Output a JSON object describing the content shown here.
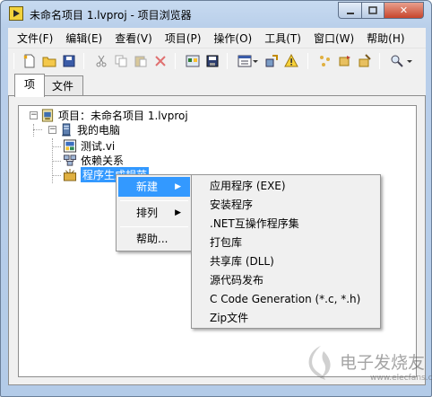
{
  "window": {
    "title": "未命名项目 1.lvproj - 项目浏览器",
    "min_icon": "minimize-icon",
    "max_icon": "maximize-icon",
    "close_glyph": "✕"
  },
  "menubar": [
    {
      "label": "文件(F)"
    },
    {
      "label": "编辑(E)"
    },
    {
      "label": "查看(V)"
    },
    {
      "label": "项目(P)"
    },
    {
      "label": "操作(O)"
    },
    {
      "label": "工具(T)"
    },
    {
      "label": "窗口(W)"
    },
    {
      "label": "帮助(H)"
    }
  ],
  "toolbar": {
    "icons": [
      "new-file-icon",
      "open-folder-icon",
      "save-all-icon",
      "cut-icon",
      "copy-icon",
      "paste-icon",
      "delete-icon",
      "project-properties-icon",
      "save-project-icon",
      "view-icon",
      "deploy-icon",
      "warning-icon",
      "build-icon",
      "build-all-icon",
      "clean-icon",
      "find-icon"
    ]
  },
  "tabs": [
    {
      "label": "项",
      "active": true
    },
    {
      "label": "文件",
      "active": false
    }
  ],
  "tree": {
    "root": {
      "label": "项目：未命名项目 1.lvproj",
      "expander": "−"
    },
    "computer": {
      "label": "我的电脑",
      "expander": "−"
    },
    "children": [
      {
        "label": "测试.vi",
        "icon": "vi-icon"
      },
      {
        "label": "依赖关系",
        "icon": "dependencies-icon"
      },
      {
        "label": "程序生成规范",
        "icon": "build-spec-icon",
        "selected": true
      }
    ]
  },
  "context_menu": {
    "items": [
      {
        "label": "新建",
        "submenu": true,
        "highlighted": true
      },
      {
        "label": "排列",
        "submenu": true,
        "highlighted": false
      },
      {
        "label": "帮助...",
        "submenu": false,
        "highlighted": false
      }
    ],
    "arrow_glyph": "▶"
  },
  "submenu": {
    "items": [
      "应用程序 (EXE)",
      "安装程序",
      ".NET互操作程序集",
      "打包库",
      "共享库 (DLL)",
      "源代码发布",
      "C Code Generation (*.c, *.h)",
      "Zip文件"
    ]
  },
  "watermark": {
    "text": "电子发烧友",
    "sub": "www.elecfans.com"
  },
  "colors": {
    "selection": "#3399ff",
    "menu_highlight": "#3399ff",
    "close_button": "#c7452c"
  }
}
